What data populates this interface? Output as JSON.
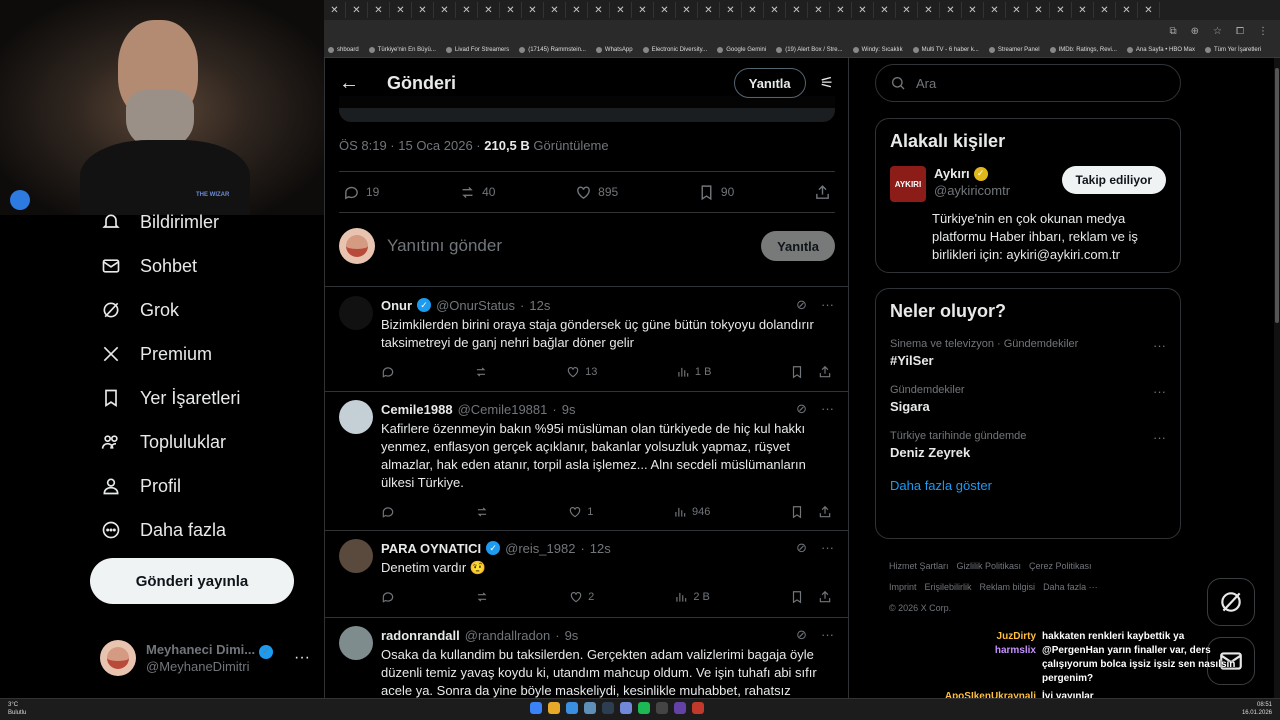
{
  "browser": {
    "bookmarks": [
      "shboard",
      "Türkiye'nin En Büyü...",
      "Livad For Streamers",
      "(17145) Rammstein...",
      "WhatsApp",
      "Electronic Diversity...",
      "Google Gemini",
      "(19) Alert Box / Stre...",
      "Windy: Sıcaklık",
      "Multi TV - 6 haber k...",
      "Streamer Panel",
      "IMDb: Ratings, Revi...",
      "Ana Sayfa • HBO Max",
      "Tüm Yer İşaretleri"
    ]
  },
  "webcam": {
    "emblem": "THE WIZAR"
  },
  "nav": {
    "items": [
      {
        "label": "Bildirimler",
        "icon": "bell-icon"
      },
      {
        "label": "Sohbet",
        "icon": "mail-icon"
      },
      {
        "label": "Grok",
        "icon": "grok-icon"
      },
      {
        "label": "Premium",
        "icon": "x-logo-icon"
      },
      {
        "label": "Yer İşaretleri",
        "icon": "bookmark-icon"
      },
      {
        "label": "Topluluklar",
        "icon": "communities-icon"
      },
      {
        "label": "Profil",
        "icon": "person-icon"
      },
      {
        "label": "Daha fazla",
        "icon": "more-circle-icon"
      }
    ],
    "post_button": "Gönderi yayınla"
  },
  "account": {
    "name": "Meyhaneci Dimi...",
    "handle": "@MeyhaneDimitri"
  },
  "header": {
    "title": "Gönderi",
    "reply_button": "Yanıtla"
  },
  "post": {
    "time": "ÖS 8:19 · 15 Oca 2026 · ",
    "views": "210,5 B",
    "views_label": " Görüntüleme",
    "replies": "19",
    "reposts": "40",
    "likes": "895",
    "bookmarks": "90"
  },
  "composer": {
    "placeholder": "Yanıtını gönder",
    "button": "Yanıtla"
  },
  "replies": [
    {
      "name": "Onur",
      "verified": true,
      "handle": "@OnurStatus",
      "time": "12s",
      "text": "Bizimkilerden birini oraya staja göndersek üç güne bütün tokyoyu dolandırır taksimetreyi de ganj nehri bağlar döner gelir",
      "likes": "13",
      "views": "1 B",
      "avatar_color": "#111111"
    },
    {
      "name": "Cemile1988",
      "verified": false,
      "handle": "@Cemile19881",
      "time": "9s",
      "text": "Kafirlere özenmeyin bakın %95i müslüman olan türkiyede de hiç kul hakkı yenmez, enflasyon gerçek açıklanır, bakanlar yolsuzluk yapmaz, rüşvet almazlar, hak eden atanır, torpil asla işlemez... Alnı secdeli müslümanların ülkesi Türkiye.",
      "likes": "1",
      "views": "946",
      "avatar_color": "#c4cfd6"
    },
    {
      "name": "PARA OYNATICI",
      "verified": true,
      "handle": "@reis_1982",
      "time": "12s",
      "text": "Denetim vardır 🤨",
      "likes": "2",
      "views": "2 B",
      "avatar_color": "#5a4a3e"
    },
    {
      "name": "radonrandall",
      "verified": false,
      "handle": "@randallradon",
      "time": "9s",
      "text": "Osaka da kullandim bu taksilerden. Gerçekten adam valizlerimi bagaja öyle düzenli temiz yavaş koydu ki, utandım mahcup oldum. Ve işin tuhafı abi sıfır acele ya. Sonra da yine böyle maskeliydi, kesinlikle muhabbet, rahatsız",
      "likes": "",
      "views": "",
      "avatar_color": "#7f8c8d"
    }
  ],
  "search": {
    "placeholder": "Ara"
  },
  "related": {
    "title": "Alakalı kişiler",
    "name": "Aykırı",
    "handle": "@aykiricomtr",
    "logo_text": "AYKIRI",
    "follow": "Takip ediliyor",
    "bio": "Türkiye'nin en çok okunan medya platformu Haber ihbarı, reklam ve iş birlikleri için: aykiri@aykiri.com.tr"
  },
  "trends": {
    "title": "Neler oluyor?",
    "items": [
      {
        "context": "Sinema ve televizyon · Gündemdekiler",
        "name": "#YilSer"
      },
      {
        "context": "Gündemdekiler",
        "name": "Sigara"
      },
      {
        "context": "Türkiye tarihinde gündemde",
        "name": "Deniz Zeyrek"
      }
    ],
    "show_more": "Daha fazla göster"
  },
  "footer": {
    "links": [
      "Hizmet Şartları",
      "Gizlilik Politikası",
      "Çerez Politikası",
      "Imprint",
      "Erişilebilirlik",
      "Reklam bilgisi",
      "Daha fazla ···"
    ],
    "copyright": "© 2026 X Corp."
  },
  "chat": [
    {
      "user": "JuzDirty",
      "color": "#ffbf3f",
      "msg": "hakkaten renkleri kaybettik ya"
    },
    {
      "user": "harmslix",
      "color": "#c690ff",
      "msg": "@PergenHan yarın finaller var, ders çalışıyorum bolca işsiz işsiz sen nasılsın pergenim?"
    },
    {
      "user": "ApoSIkenUkraynali",
      "color": "#ffbf3f",
      "msg": "İyi yayınlar"
    }
  ],
  "taskbar": {
    "temp": "3°C",
    "condition": "Bulutlu",
    "time": "08:51",
    "date": "16.01.2026"
  }
}
